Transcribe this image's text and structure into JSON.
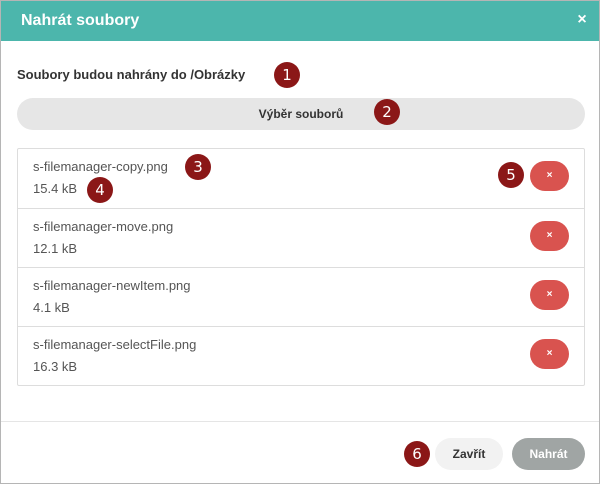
{
  "dialog": {
    "title": "Nahrát soubory",
    "close_icon": "×",
    "destination_text": "Soubory budou nahrány do /Obrázky",
    "select_files_label": "Výběr souborů"
  },
  "files": [
    {
      "name": "s-filemanager-copy.png",
      "size": "15.4 kB",
      "remove_icon": "×"
    },
    {
      "name": "s-filemanager-move.png",
      "size": "12.1 kB",
      "remove_icon": "×"
    },
    {
      "name": "s-filemanager-newItem.png",
      "size": "4.1 kB",
      "remove_icon": "×"
    },
    {
      "name": "s-filemanager-selectFile.png",
      "size": "16.3 kB",
      "remove_icon": "×"
    }
  ],
  "footer": {
    "close_label": "Zavřít",
    "upload_label": "Nahrát"
  },
  "markers": [
    "1",
    "2",
    "3",
    "4",
    "5",
    "6"
  ],
  "colors": {
    "header": "#4cb6ac",
    "remove_button": "#d9534f",
    "upload_button_disabled": "#a0a5a4",
    "marker": "#8b1717"
  }
}
